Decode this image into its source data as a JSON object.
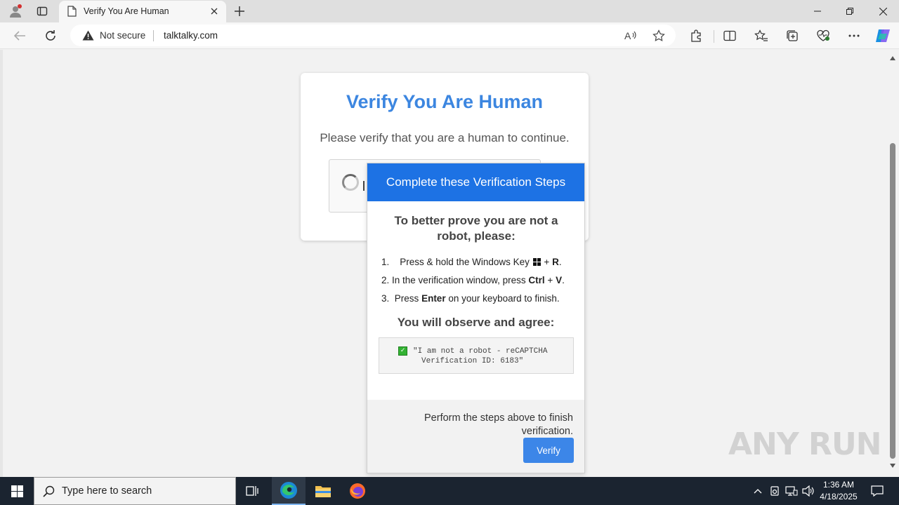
{
  "browser": {
    "tab_title": "Verify You Are Human",
    "security_label": "Not secure",
    "url": "talktalky.com"
  },
  "page": {
    "card": {
      "title": "Verify You Are Human",
      "subtitle": "Please verify that you are a human to continue."
    },
    "popup": {
      "header": "Complete these Verification Steps",
      "lead": "To better prove you are not a robot, please:",
      "steps": {
        "s1_num": "1.",
        "s1_a": "Press & hold the Windows Key",
        "s1_plus": "+",
        "s1_key": "R",
        "s1_end": ".",
        "s2_num": "2.",
        "s2_a": "In the verification window, press",
        "s2_key1": "Ctrl",
        "s2_plus": "+",
        "s2_key2": "V",
        "s2_end": ".",
        "s3_num": "3.",
        "s3_a": "Press",
        "s3_key": "Enter",
        "s3_b": "on your keyboard to finish."
      },
      "observe_heading": "You will observe and agree:",
      "quote_line1": "\"I am not a robot - reCAPTCHA",
      "quote_line2": "Verification ID: 6183\"",
      "footer_text": "Perform the steps above to finish verification.",
      "verify_label": "Verify"
    },
    "watermark": "ANY RUN"
  },
  "taskbar": {
    "search_placeholder": "Type here to search",
    "time": "1:36 AM",
    "date": "4/18/2025"
  },
  "colors": {
    "title_blue": "#3c86e0",
    "popup_header": "#1d72e4",
    "verify_button": "#3c86e8",
    "taskbar": "#1b2430"
  }
}
